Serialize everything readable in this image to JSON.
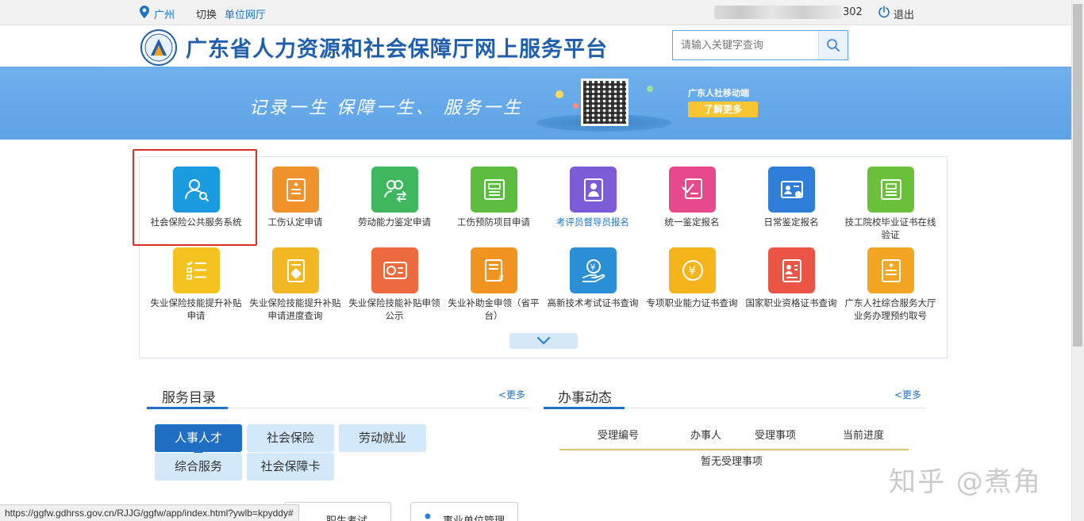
{
  "topbar": {
    "city": "广州",
    "switch_label": "切换",
    "unit_hall": "单位网厅",
    "user_suffix": "302",
    "logout": "退出"
  },
  "header": {
    "title": "广东省人力资源和社会保障厅网上服务平台",
    "search_placeholder": "请输入关键字查询"
  },
  "banner": {
    "slogan": "记录一生  保障一生、 服务一生",
    "mobile_title": "广东人社移动端",
    "learn_more": "了解更多"
  },
  "services": [
    {
      "label": "社会保险公共服务系统",
      "icon": "user-search-icon",
      "color": "#1a9be0"
    },
    {
      "label": "工伤认定申请",
      "icon": "document-plus-icon",
      "color": "#f0932b"
    },
    {
      "label": "劳动能力鉴定申请",
      "icon": "users-exchange-icon",
      "color": "#3fb75f"
    },
    {
      "label": "工伤预防项目申请",
      "icon": "id-card-icon",
      "color": "#5cbd3f"
    },
    {
      "label": "考评员督导员报名",
      "icon": "badge-person-icon",
      "color": "#7b5bd6"
    },
    {
      "label": "统一鉴定报名",
      "icon": "signup-form-icon",
      "color": "#e64a8c"
    },
    {
      "label": "日常鉴定报名",
      "icon": "id-card-edit-icon",
      "color": "#2f7fd8"
    },
    {
      "label": "技工院校毕业证书在线验证",
      "icon": "certificate-check-icon",
      "color": "#6bc23a"
    },
    {
      "label": "失业保险技能提升补贴申请",
      "icon": "checklist-icon",
      "color": "#f5c31f"
    },
    {
      "label": "失业保险技能提升补贴申请进度查询",
      "icon": "progress-query-icon",
      "color": "#f2b824"
    },
    {
      "label": "失业保险技能补贴申领公示",
      "icon": "subsidy-card-icon",
      "color": "#ee6a3f"
    },
    {
      "label": "失业补助金申领（省平台）",
      "icon": "money-document-icon",
      "color": "#f29422"
    },
    {
      "label": "高新技术考试证书查询",
      "icon": "hand-coin-icon",
      "color": "#2b8fd6"
    },
    {
      "label": "专项职业能力证书查询",
      "icon": "yuan-coin-icon",
      "color": "#f5b51a"
    },
    {
      "label": "国家职业资格证书查询",
      "icon": "certificate-person-icon",
      "color": "#ea5545"
    },
    {
      "label": "广东人社综合服务大厅业务办理预约取号",
      "icon": "appointment-document-icon",
      "color": "#f2a623"
    }
  ],
  "directory": {
    "title": "服务目录",
    "more": "<更多",
    "categories": [
      "人事人才",
      "社会保险",
      "劳动就业",
      "综合服务",
      "社会保障卡"
    ]
  },
  "business": {
    "title": "办事动态",
    "more": "<更多",
    "columns": [
      "受理编号",
      "办事人",
      "受理事项",
      "当前进度"
    ],
    "empty": "暂无受理事项"
  },
  "bottom": {
    "card1": "事业单位管理",
    "card_partial": "职生考试",
    "status_url": "https://ggfw.gdhrss.gov.cn/RJJG/ggfw/app/index.html?ywlb=kpyddy#"
  },
  "watermark": "知乎 @煮角"
}
